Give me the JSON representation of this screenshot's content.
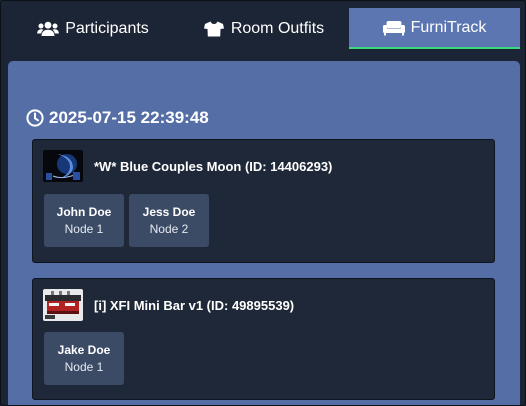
{
  "tabs": [
    {
      "label": "Participants",
      "icon": "users-icon",
      "active": false
    },
    {
      "label": "Room Outfits",
      "icon": "shirt-icon",
      "active": false
    },
    {
      "label": "FurniTrack",
      "icon": "couch-icon",
      "active": true
    }
  ],
  "colors": {
    "background": "#1c2535",
    "panel": "#556fa6",
    "active_tab": "#5b76b0",
    "active_indicator": "#37d97a",
    "card": "#1f2838",
    "chip": "#3b4b66"
  },
  "timestamp": {
    "icon": "clock-icon",
    "text": "2025-07-15 22:39:48"
  },
  "items": [
    {
      "title": "*W* Blue Couples Moon (ID: 14406293)",
      "participants": [
        {
          "name": "John Doe",
          "node": "Node 1"
        },
        {
          "name": "Jess Doe",
          "node": "Node 2"
        }
      ]
    },
    {
      "title": "[i] XFI Mini Bar v1 (ID: 49895539)",
      "participants": [
        {
          "name": "Jake Doe",
          "node": "Node 1"
        }
      ]
    }
  ]
}
